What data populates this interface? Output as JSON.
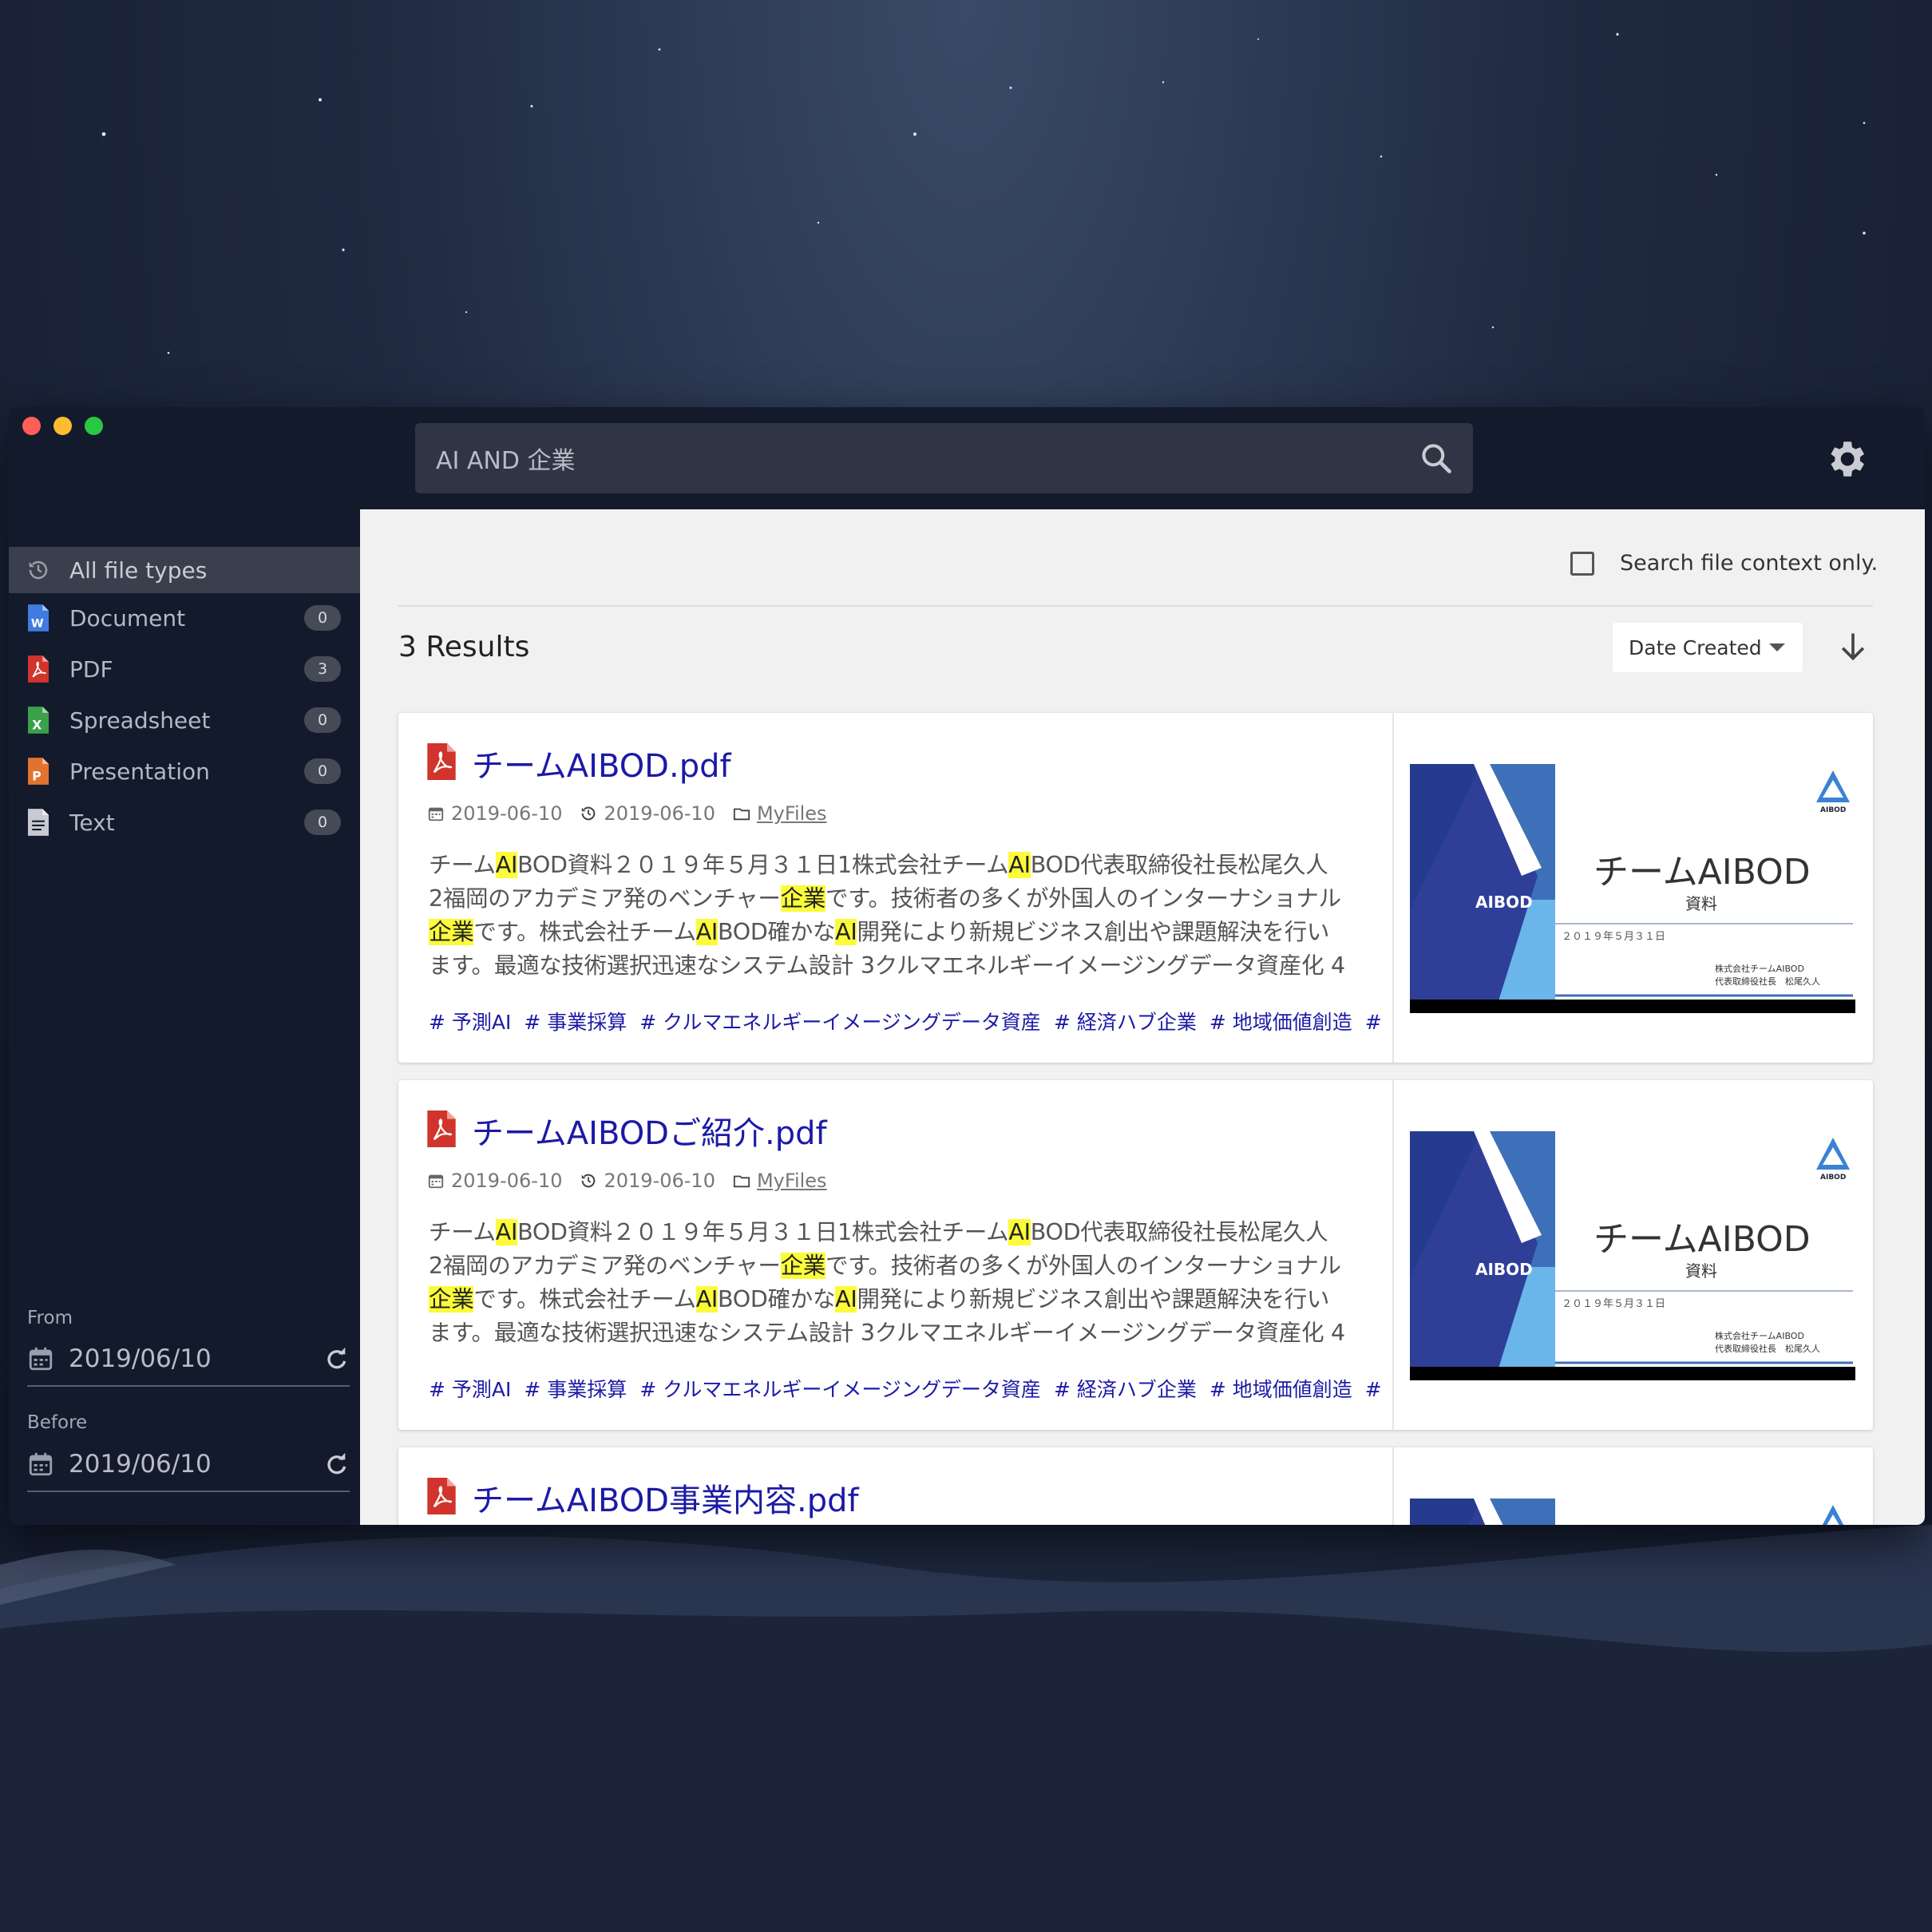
{
  "search": {
    "query": "AI AND 企業"
  },
  "sidebar": {
    "items": [
      {
        "label": "All file types",
        "icon": "history-icon",
        "count": ""
      },
      {
        "label": "Document",
        "icon": "word-file-icon",
        "count": "0"
      },
      {
        "label": "PDF",
        "icon": "pdf-file-icon",
        "count": "3"
      },
      {
        "label": "Spreadsheet",
        "icon": "excel-file-icon",
        "count": "0"
      },
      {
        "label": "Presentation",
        "icon": "powerpoint-file-icon",
        "count": "0"
      },
      {
        "label": "Text",
        "icon": "text-file-icon",
        "count": "0"
      }
    ],
    "from_label": "From",
    "from_value": "2019/06/10",
    "before_label": "Before",
    "before_value": "2019/06/10"
  },
  "main": {
    "context_only_label": "Search file context only.",
    "results_label": "3 Results",
    "sort_label": "Date Created",
    "results": [
      {
        "title": "チームAIBOD.pdf",
        "created": "2019-06-10",
        "modified": "2019-06-10",
        "folder": "MyFiles",
        "snippet": [
          [
            "チーム",
            "AI",
            "BOD資料２０１９年５月３１日1株式会社チーム",
            "AI",
            "BOD代表取締役社長松尾久人"
          ],
          [
            "2福岡のアカデミア発のベンチャー",
            "企業",
            "です。技術者の多くが外国人のインターナショナル"
          ],
          [
            "",
            "企業",
            "です。株式会社チーム",
            "AI",
            "BOD確かな",
            "AI",
            "開発により新規ビジネス創出や課題解決を行い"
          ],
          [
            "ます。最適な技術選択迅速なシステム設計 3クルマエネルギーイメージングデータ資産化 4"
          ]
        ],
        "tags": [
          "# 予測AI",
          "# 事業採算",
          "# クルマエネルギーイメージングデータ資産",
          "# 経済ハブ企業",
          "# 地域価値創造",
          "#"
        ],
        "thumb_title": "チームAIBOD",
        "thumb_sub": "資料",
        "thumb_date": "２０１９年５月３１日",
        "thumb_company": "株式会社チームAIBOD",
        "thumb_person": "代表取締役社長　松尾久人",
        "thumb_logo": "AIBOD",
        "thumb_logo_small": "AIBOD"
      },
      {
        "title": "チームAIBODご紹介.pdf",
        "created": "2019-06-10",
        "modified": "2019-06-10",
        "folder": "MyFiles",
        "snippet": [
          [
            "チーム",
            "AI",
            "BOD資料２０１９年５月３１日1株式会社チーム",
            "AI",
            "BOD代表取締役社長松尾久人"
          ],
          [
            "2福岡のアカデミア発のベンチャー",
            "企業",
            "です。技術者の多くが外国人のインターナショナル"
          ],
          [
            "",
            "企業",
            "です。株式会社チーム",
            "AI",
            "BOD確かな",
            "AI",
            "開発により新規ビジネス創出や課題解決を行い"
          ],
          [
            "ます。最適な技術選択迅速なシステム設計 3クルマエネルギーイメージングデータ資産化 4"
          ]
        ],
        "tags": [
          "# 予測AI",
          "# 事業採算",
          "# クルマエネルギーイメージングデータ資産",
          "# 経済ハブ企業",
          "# 地域価値創造",
          "#"
        ],
        "thumb_title": "チームAIBOD",
        "thumb_sub": "資料",
        "thumb_date": "２０１９年５月３１日",
        "thumb_company": "株式会社チームAIBOD",
        "thumb_person": "代表取締役社長　松尾久人",
        "thumb_logo": "AIBOD",
        "thumb_logo_small": "AIBOD"
      },
      {
        "title": "チームAIBOD事業内容.pdf"
      }
    ]
  },
  "colors": {
    "accent_link": "#1c1aa6",
    "highlight": "#fbfb3a",
    "window_bg": "#131a2c",
    "pdf_red": "#d0342c"
  }
}
